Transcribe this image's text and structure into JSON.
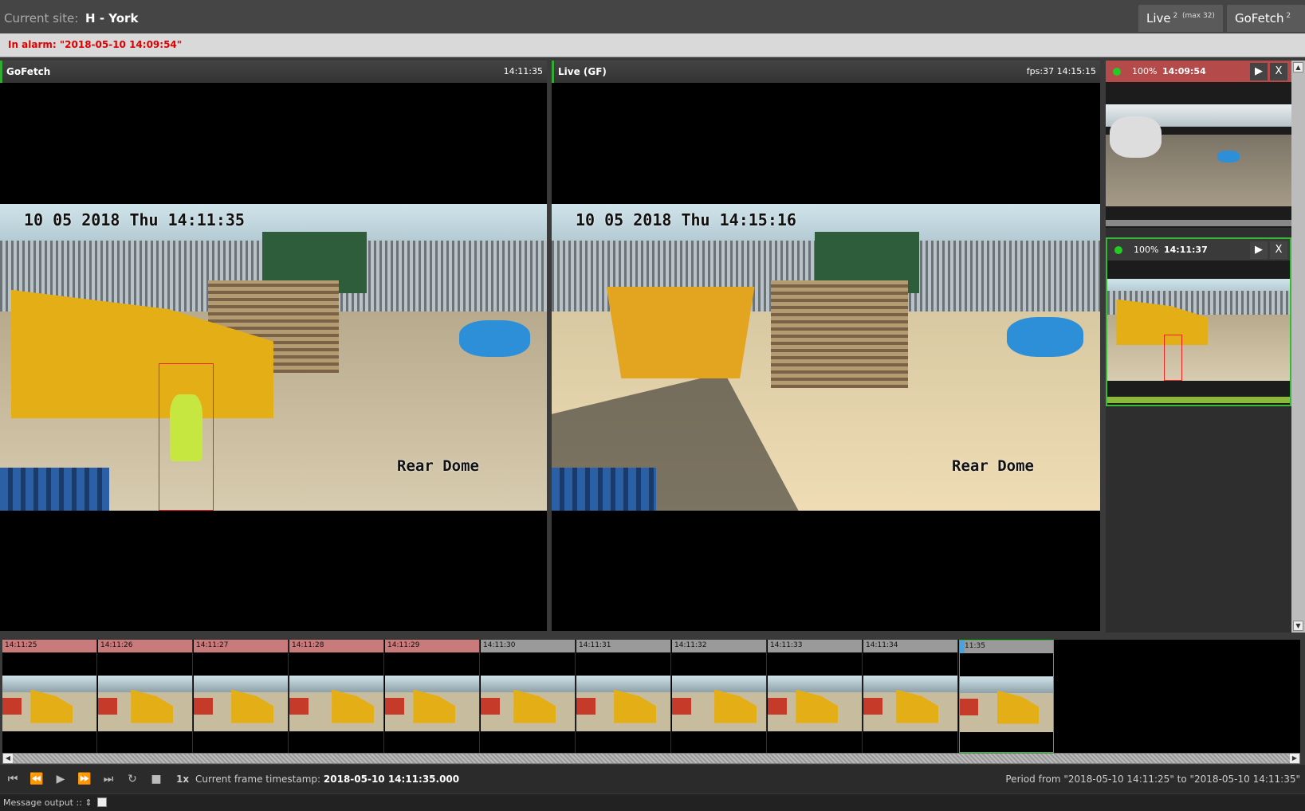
{
  "header": {
    "site_label": "Current site:",
    "site_value": "H - York",
    "tabs": [
      {
        "label": "Live",
        "count": "2",
        "extra": "(max 32)"
      },
      {
        "label": "GoFetch",
        "count": "2"
      }
    ]
  },
  "alarm": {
    "text": "In alarm: \"2018-05-10 14:09:54\""
  },
  "panels": {
    "gofetch": {
      "title": "GoFetch",
      "time": "14:11:35",
      "osd_date": "10 05 2018 Thu 14:11:35",
      "osd_cam": "Rear Dome"
    },
    "live": {
      "title": "Live (GF)",
      "fps_time": "fps:37 14:15:15",
      "osd_date": "10 05 2018 Thu 14:15:16",
      "osd_cam": "Rear Dome"
    }
  },
  "side": {
    "cards": [
      {
        "pct": "100%",
        "time": "14:09:54",
        "play": "▶",
        "close": "X"
      },
      {
        "pct": "100%",
        "time": "14:11:37",
        "play": "▶",
        "close": "X"
      }
    ]
  },
  "timeline": {
    "frames": [
      "14:11:25",
      "14:11:26",
      "14:11:27",
      "14:11:28",
      "14:11:29",
      "14:11:30",
      "14:11:31",
      "14:11:32",
      "14:11:33",
      "14:11:34",
      ":11:35"
    ],
    "alarm_frames_count_label": "",
    "colors": {
      "alarm": "#c97a7a",
      "normal": "#9a9a9a",
      "selected": "#3b3"
    }
  },
  "controls": {
    "icons": [
      "skip-start-icon",
      "rewind-icon",
      "play-icon",
      "fast-forward-icon",
      "skip-end-icon",
      "loop-icon",
      "save-icon"
    ],
    "speed": "1x",
    "current_label": "Current frame timestamp:",
    "current_value": "2018-05-10 14:11:35.000",
    "period": "Period from \"2018-05-10 14:11:25\" to \"2018-05-10 14:11:35\""
  },
  "message": {
    "label": "Message output ::",
    "spinner": "⇕"
  }
}
